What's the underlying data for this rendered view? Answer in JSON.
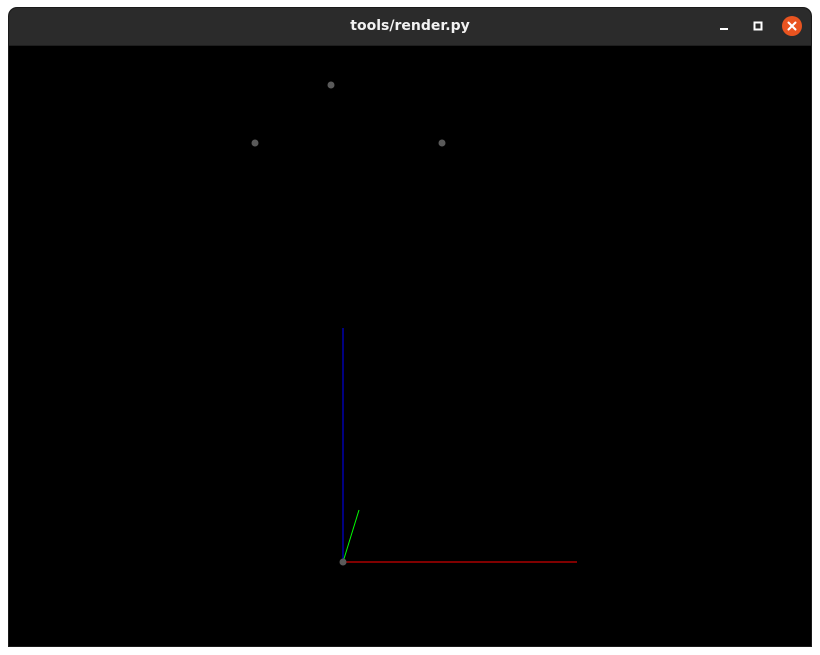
{
  "window": {
    "title": "tools/render.py"
  },
  "controls": {
    "minimize_icon": "minimize-icon",
    "maximize_icon": "maximize-icon",
    "close_icon": "close-icon"
  },
  "scene": {
    "background": "#000000",
    "point_color": "#5a5a5a",
    "axis_colors": {
      "x": "#ff0000",
      "y": "#00ff00",
      "z": "#0000ff"
    }
  }
}
